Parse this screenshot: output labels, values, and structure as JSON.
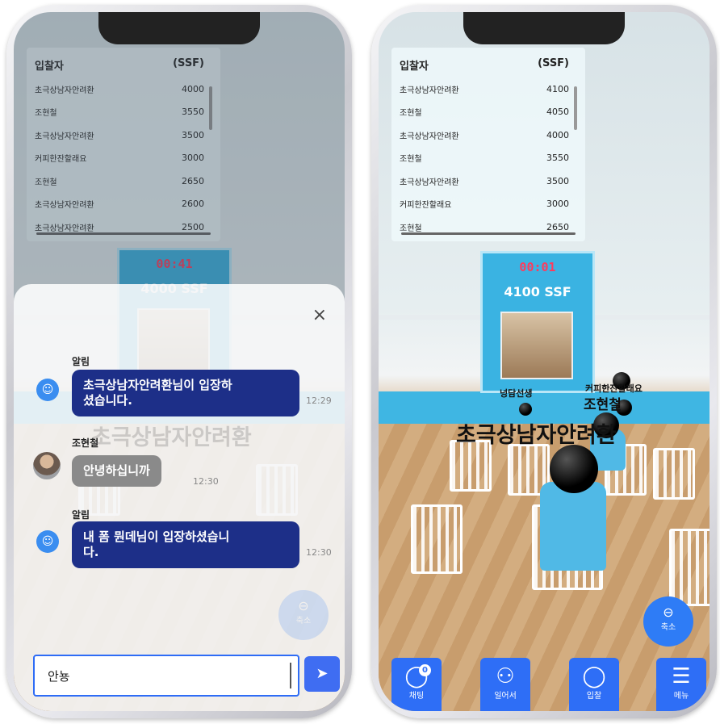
{
  "left": {
    "bids": {
      "header_user": "입찰자",
      "header_unit": "(SSF)",
      "rows": [
        {
          "user": "초극상남자안려환",
          "amount": "4000"
        },
        {
          "user": "조현철",
          "amount": "3550"
        },
        {
          "user": "초극상남자안려환",
          "amount": "3500"
        },
        {
          "user": "커피한잔할래요",
          "amount": "3000"
        },
        {
          "user": "조현철",
          "amount": "2650"
        },
        {
          "user": "초극상남자안려환",
          "amount": "2600"
        },
        {
          "user": "초극상남자안려환",
          "amount": "2500"
        }
      ]
    },
    "board": {
      "timer": "00:41",
      "price": "4000 SSF"
    },
    "scene_name": "초극상남자안려환",
    "chat": {
      "close_icon": "×",
      "messages": [
        {
          "sender": "알림",
          "text_line1": "초극상남자안려환님이 입장하",
          "text_line2": "셨습니다.",
          "time": "12:29"
        },
        {
          "sender": "조현철",
          "text": "안녕하십니까",
          "time": "12:30"
        },
        {
          "sender": "알림",
          "text_line1": "내 폼 뭔데님이 입장하셨습니",
          "text_line2": "다.",
          "time": "12:30"
        }
      ],
      "input_value": "안뇽",
      "send_icon": "paper-plane-icon"
    },
    "zoom_label": "축소"
  },
  "right": {
    "bids": {
      "header_user": "입찰자",
      "header_unit": "(SSF)",
      "rows": [
        {
          "user": "초극상남자안려환",
          "amount": "4100"
        },
        {
          "user": "조현철",
          "amount": "4050"
        },
        {
          "user": "초극상남자안려환",
          "amount": "4000"
        },
        {
          "user": "조현철",
          "amount": "3550"
        },
        {
          "user": "초극상남자안려환",
          "amount": "3500"
        },
        {
          "user": "커피한잔할래요",
          "amount": "3000"
        },
        {
          "user": "조현철",
          "amount": "2650"
        }
      ]
    },
    "board": {
      "timer": "00:01",
      "price": "4100 SSF"
    },
    "scene_names": {
      "n1": "넝담선생",
      "n2": "커피한잔할래요",
      "n3": "조현철",
      "n4": "초극상남자안려환"
    },
    "zoom_label": "축소",
    "nav": {
      "chat": {
        "label": "채팅",
        "badge": "0"
      },
      "standup": {
        "label": "일어서"
      },
      "bid": {
        "label": "입찰"
      },
      "menu": {
        "label": "메뉴"
      }
    }
  },
  "colors": {
    "primary": "#2e6ef6",
    "bubble_dark": "#1d2f88",
    "stage": "#3fb6e3",
    "timer": "#ff3a5c"
  }
}
